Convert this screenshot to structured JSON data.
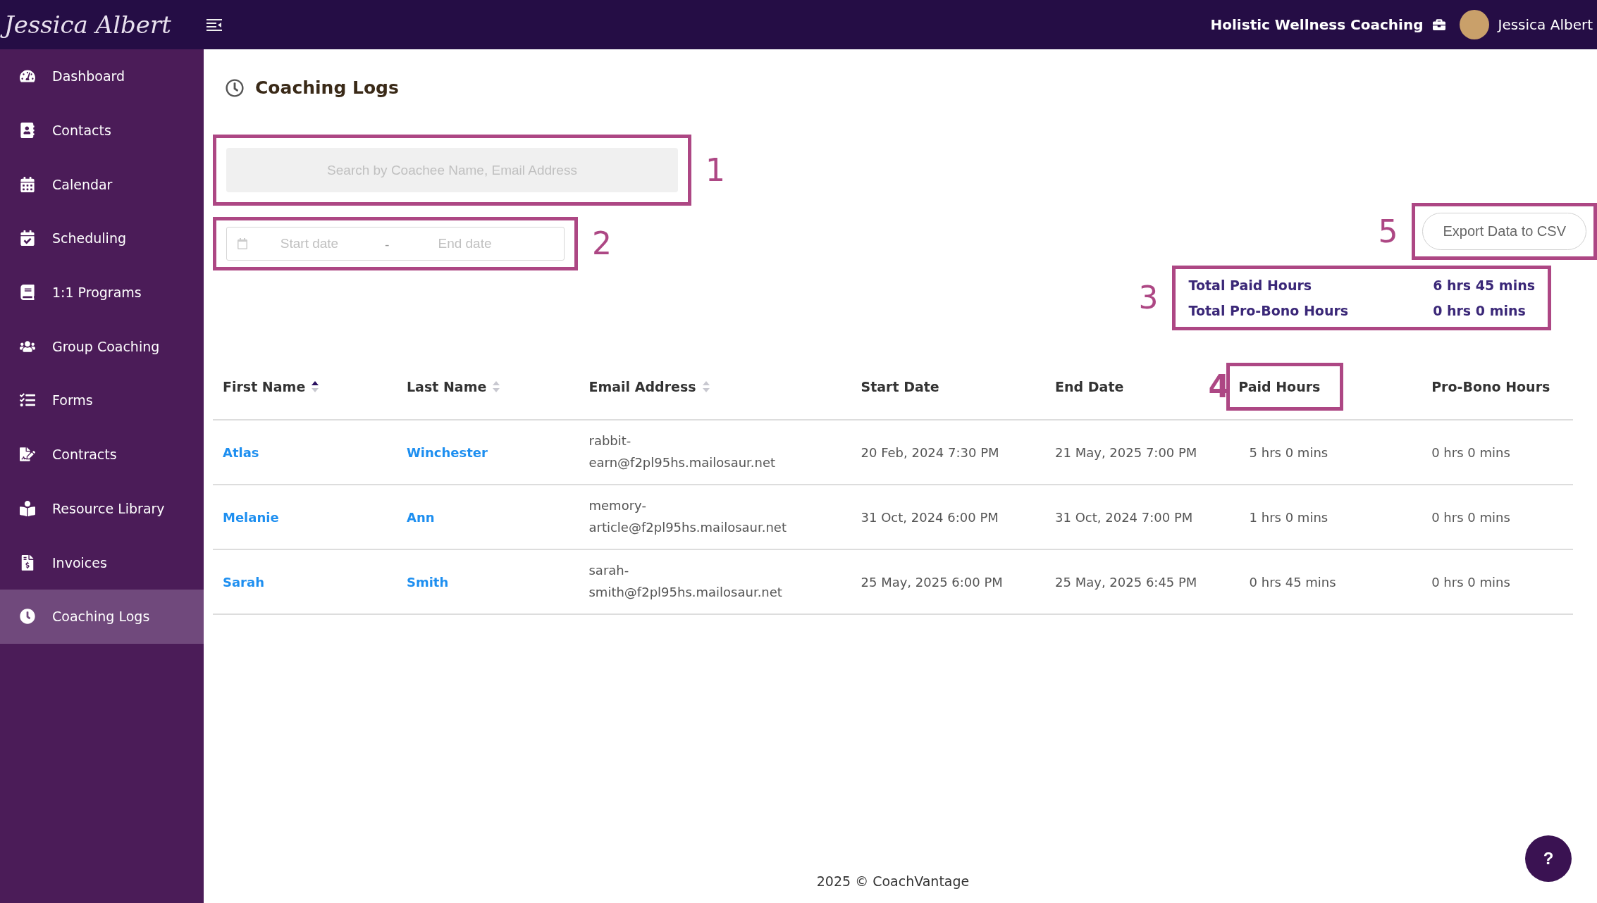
{
  "header": {
    "logo": "Jessica Albert",
    "business": "Holistic Wellness Coaching",
    "user": "Jessica Albert"
  },
  "sidebar": {
    "items": [
      {
        "label": "Dashboard",
        "selected": false
      },
      {
        "label": "Contacts",
        "selected": false
      },
      {
        "label": "Calendar",
        "selected": false
      },
      {
        "label": "Scheduling",
        "selected": false
      },
      {
        "label": "1:1 Programs",
        "selected": false
      },
      {
        "label": "Group Coaching",
        "selected": false
      },
      {
        "label": "Forms",
        "selected": false
      },
      {
        "label": "Contracts",
        "selected": false
      },
      {
        "label": "Resource Library",
        "selected": false
      },
      {
        "label": "Invoices",
        "selected": false
      },
      {
        "label": "Coaching Logs",
        "selected": true
      }
    ]
  },
  "page": {
    "title": "Coaching Logs"
  },
  "search": {
    "placeholder": "Search by Coachee Name, Email Address",
    "callout": "1"
  },
  "date_range": {
    "start_placeholder": "Start date",
    "separator": "-",
    "end_placeholder": "End date",
    "callout": "2"
  },
  "export": {
    "label": "Export Data to CSV",
    "callout": "5"
  },
  "totals": {
    "callout": "3",
    "rows": [
      {
        "label": "Total Paid Hours",
        "value": "6 hrs 45 mins"
      },
      {
        "label": "Total Pro-Bono Hours",
        "value": "0 hrs 0 mins"
      }
    ]
  },
  "table": {
    "columns": [
      {
        "label": "First Name",
        "sorted_ascending": true
      },
      {
        "label": "Last Name",
        "sorted_ascending": false
      },
      {
        "label": "Email Address",
        "sorted_ascending": false
      },
      {
        "label": "Start Date"
      },
      {
        "label": "End Date"
      },
      {
        "label": "Paid Hours",
        "callout": "4"
      },
      {
        "label": "Pro-Bono Hours"
      }
    ],
    "rows": [
      [
        "Atlas",
        "Winchester",
        "rabbit-earn@f2pl95hs.mailosaur.net",
        "20 Feb, 2024 7:30 PM",
        "21 May, 2025 7:00 PM",
        "5 hrs 0 mins",
        "0 hrs 0 mins"
      ],
      [
        "Melanie",
        "Ann",
        "memory-article@f2pl95hs.mailosaur.net",
        "31 Oct, 2024 6:00 PM",
        "31 Oct, 2024 7:00 PM",
        "1 hrs 0 mins",
        "0 hrs 0 mins"
      ],
      [
        "Sarah",
        "Smith",
        "sarah-smith@f2pl95hs.mailosaur.net",
        "25 May, 2025 6:00 PM",
        "25 May, 2025 6:45 PM",
        "0 hrs 45 mins",
        "0 hrs 0 mins"
      ]
    ]
  },
  "footer": {
    "text": "2025 © CoachVantage"
  },
  "help_button": {
    "label": "?"
  }
}
